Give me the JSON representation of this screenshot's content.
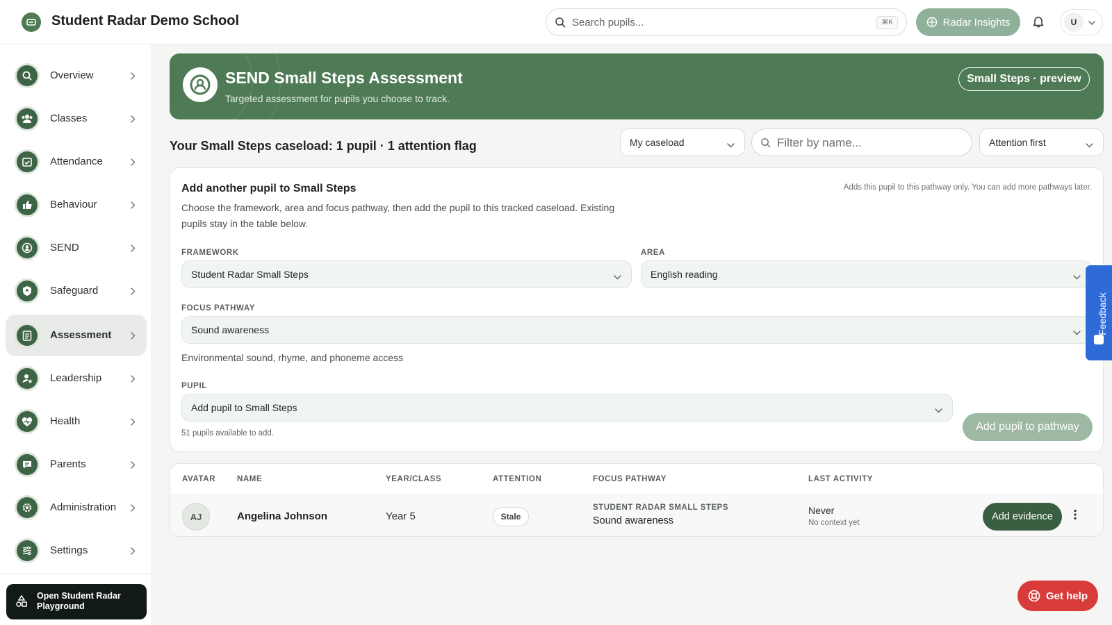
{
  "app": {
    "school_name": "Student Radar Demo School"
  },
  "topbar": {
    "search_placeholder": "Search pupils...",
    "search_shortcut": "⌘K",
    "insights_label": "Radar Insights",
    "user_initial": "U"
  },
  "sidebar": {
    "items": [
      {
        "label": "Overview",
        "icon": "search-icon"
      },
      {
        "label": "Classes",
        "icon": "users-icon"
      },
      {
        "label": "Attendance",
        "icon": "calendar-check-icon"
      },
      {
        "label": "Behaviour",
        "icon": "thumbs-up-icon"
      },
      {
        "label": "SEND",
        "icon": "person-circle-icon"
      },
      {
        "label": "Safeguard",
        "icon": "shield-icon"
      },
      {
        "label": "Assessment",
        "icon": "clipboard-icon",
        "active": true
      },
      {
        "label": "Leadership",
        "icon": "user-star-icon"
      },
      {
        "label": "Health",
        "icon": "heart-pulse-icon"
      },
      {
        "label": "Parents",
        "icon": "chat-icon"
      },
      {
        "label": "Administration",
        "icon": "gear-icon"
      },
      {
        "label": "Settings",
        "icon": "sliders-icon"
      }
    ],
    "playground_label": "Open Student Radar Playground"
  },
  "banner": {
    "title": "SEND Small Steps Assessment",
    "subtitle": "Targeted assessment for pupils you choose to track.",
    "badge": "Small Steps · preview"
  },
  "caseload": {
    "title": "Your Small Steps caseload: 1 pupil · 1 attention flag",
    "scope_select": "My caseload",
    "filter_placeholder": "Filter by name...",
    "sort_select": "Attention first"
  },
  "add_card": {
    "title": "Add another pupil to Small Steps",
    "note": "Adds this pupil to this pathway only. You can add more pathways later.",
    "description": "Choose the framework, area and focus pathway, then add the pupil to this tracked caseload. Existing pupils stay in the table below.",
    "framework_label": "FRAMEWORK",
    "framework_value": "Student Radar Small Steps",
    "area_label": "AREA",
    "area_value": "English reading",
    "pathway_label": "FOCUS PATHWAY",
    "pathway_value": "Sound awareness",
    "pathway_description": "Environmental sound, rhyme, and phoneme access",
    "pupil_label": "PUPIL",
    "pupil_value": "Add pupil to Small Steps",
    "available_text": "51 pupils available to add.",
    "add_button": "Add pupil to pathway"
  },
  "table": {
    "headers": [
      "AVATAR",
      "NAME",
      "YEAR/CLASS",
      "ATTENTION",
      "FOCUS PATHWAY",
      "LAST ACTIVITY"
    ],
    "rows": [
      {
        "initials": "AJ",
        "name": "Angelina Johnson",
        "year": "Year 5",
        "attention": "Stale",
        "framework": "STUDENT RADAR SMALL STEPS",
        "pathway": "Sound awareness",
        "last_activity": "Never",
        "context": "No context yet",
        "action": "Add evidence"
      }
    ]
  },
  "feedback_label": "Feedback",
  "help_label": "Get help",
  "colors": {
    "brand_green": "#4e7a55",
    "dark_green": "#3a5e41",
    "muted_green": "#9db8a3",
    "help_red": "#d93b3b",
    "feedback_blue": "#2f6bd8"
  }
}
